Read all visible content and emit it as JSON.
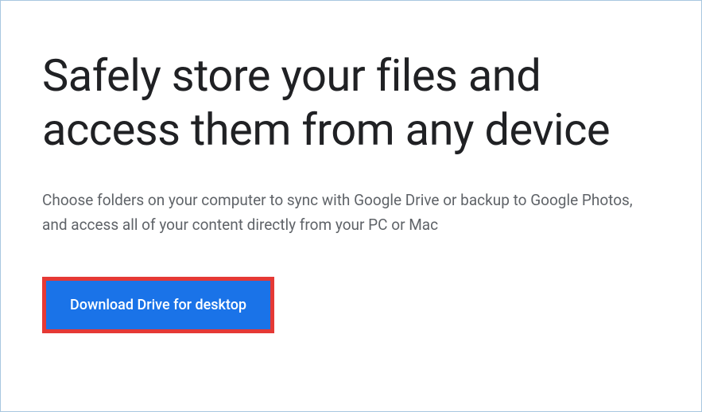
{
  "main": {
    "headline": "Safely store your files and access them from any device",
    "description": "Choose folders on your computer to sync with Google Drive or backup to Google Photos, and access all of your content directly from your PC or Mac",
    "download_button_label": "Download Drive for desktop"
  }
}
